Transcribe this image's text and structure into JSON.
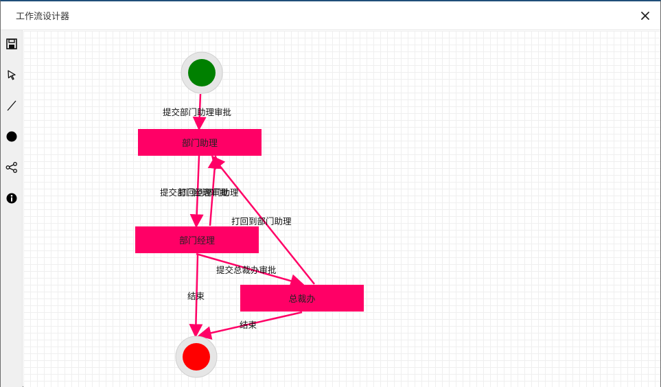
{
  "window": {
    "title": "工作流设计器"
  },
  "toolbar": {
    "tools": [
      "save-icon",
      "select-pointer-icon",
      "line-icon",
      "circle-icon",
      "branch-icon",
      "info-icon"
    ]
  },
  "diagram": {
    "start_color": "#008000",
    "end_color": "#ff0000",
    "node_color": "#ff0066",
    "edge_color": "#ff0066",
    "nodes": {
      "assistant": "部门助理",
      "manager": "部门经理",
      "ceo": "总裁办"
    },
    "edges": {
      "start_to_assistant": "提交部门助理审批",
      "assistant_to_manager": "提交部门经理审批",
      "manager_to_assistant": "打回到部门助理",
      "ceo_to_assistant": "打回到部门助理",
      "manager_to_ceo": "提交总裁办审批",
      "manager_to_end": "结束",
      "ceo_to_end": "结束"
    }
  }
}
